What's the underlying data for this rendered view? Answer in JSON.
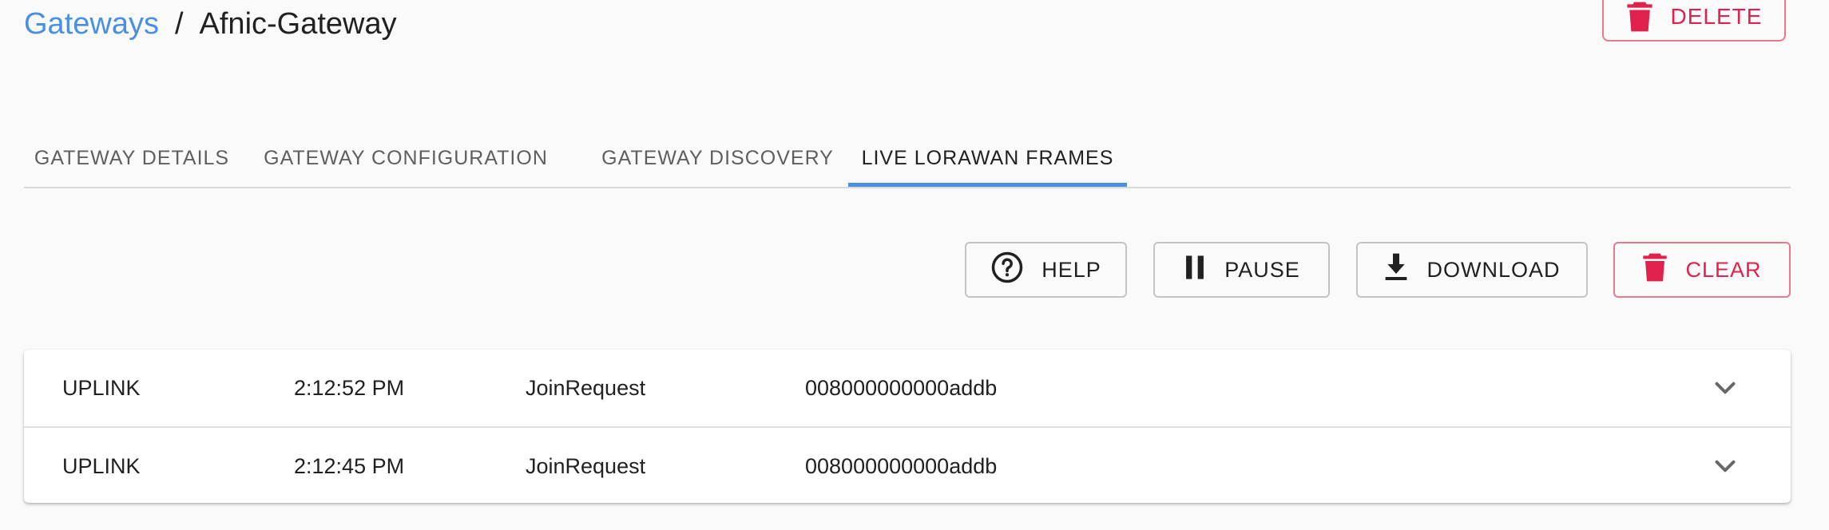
{
  "breadcrumb": {
    "parent": "Gateways",
    "separator": "/",
    "current": "Afnic-Gateway"
  },
  "actions": {
    "delete_label": "DELETE"
  },
  "tabs": [
    {
      "label": "GATEWAY DETAILS",
      "active": false
    },
    {
      "label": "GATEWAY CONFIGURATION",
      "active": false
    },
    {
      "label": "GATEWAY DISCOVERY",
      "active": false
    },
    {
      "label": "LIVE LORAWAN FRAMES",
      "active": true
    }
  ],
  "toolbar": {
    "help_label": "HELP",
    "pause_label": "PAUSE",
    "download_label": "DOWNLOAD",
    "clear_label": "CLEAR"
  },
  "frames": [
    {
      "direction": "UPLINK",
      "time": "2:12:52 PM",
      "type": "JoinRequest",
      "dev_eui": "008000000000addb"
    },
    {
      "direction": "UPLINK",
      "time": "2:12:45 PM",
      "type": "JoinRequest",
      "dev_eui": "008000000000addb"
    }
  ],
  "colors": {
    "link": "#4a90e2",
    "danger": "#e0214d",
    "active_tab_indicator": "#4a90e2"
  },
  "icons": {
    "delete": "trash-icon",
    "help": "help-circle-icon",
    "pause": "pause-icon",
    "download": "download-icon",
    "clear": "trash-icon",
    "expand": "chevron-down-icon"
  }
}
